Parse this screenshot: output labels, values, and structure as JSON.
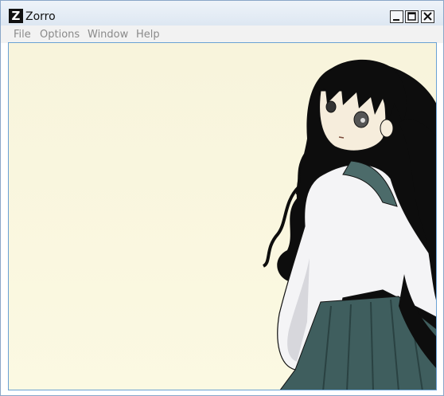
{
  "window": {
    "title": "Zorro",
    "app_icon_letter": "Z",
    "controls": [
      "minimize",
      "maximize",
      "close"
    ]
  },
  "menu": {
    "items": [
      {
        "label": "File"
      },
      {
        "label": "Options"
      },
      {
        "label": "Window"
      },
      {
        "label": "Help"
      }
    ]
  },
  "content": {
    "image_subject": "anime-girl-illustration",
    "background_color": "#f8f4dc",
    "colors": {
      "hair": "#0d0d0d",
      "uniform": "#f4f4f6",
      "skirt": "#3f5e5e",
      "collar": "#4c6b6a",
      "skin": "#f6eddc"
    }
  }
}
